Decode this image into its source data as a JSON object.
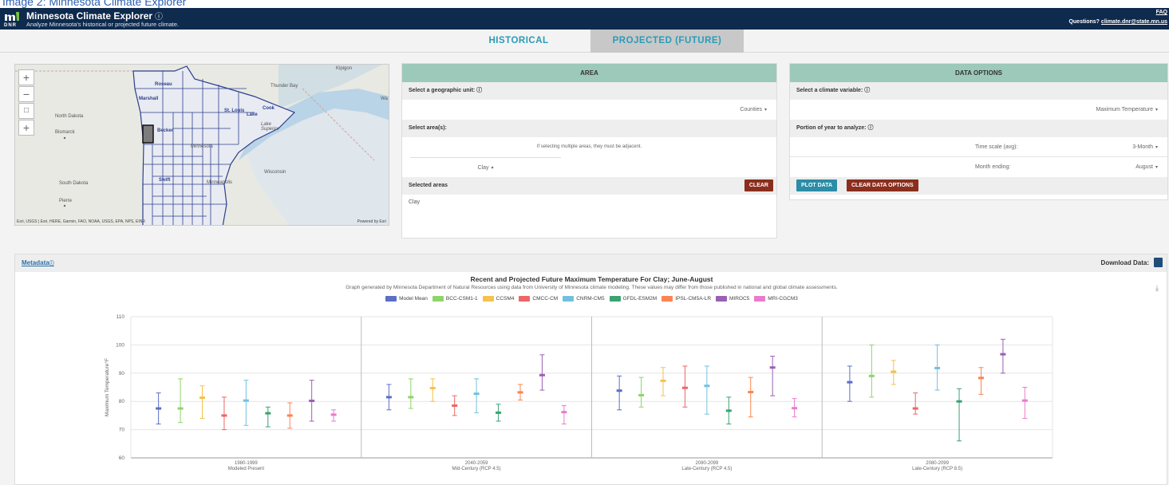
{
  "caption": "Image 2: Minnesota Climate Explorer",
  "header": {
    "title": "Minnesota Climate Explorer",
    "info_glyph": "ⓘ",
    "subtitle": "Analyze Minnesota's historical or projected future climate.",
    "dnr": "DNR",
    "faq": "FAQ",
    "questions_label": "Questions?",
    "questions_email": "climate.dnr@state.mn.us"
  },
  "tabs": {
    "historical": "HISTORICAL",
    "projected": "PROJECTED (FUTURE)"
  },
  "map": {
    "zoom_in": "+",
    "zoom_out": "−",
    "box": "□",
    "plus2": "+",
    "labels": {
      "kipigon": "Kipigon",
      "thunder_bay": "Thunder Bay",
      "north_dakota": "North Dakota",
      "bismarck": "Bismarck",
      "lake_superior": "Lake Superior",
      "south_dakota": "South Dakota",
      "pierre": "Pierre",
      "wisconsin": "Wisconsin",
      "minneapolis": "Minneapolis",
      "minnesota": "Minnesota",
      "roseau": "Roseau",
      "marshall": "Marshall",
      "cook": "Cook",
      "lake": "Lake",
      "st_louis": "St. Louis",
      "becker": "Becker",
      "swift": "Swift",
      "wa": "Wa"
    },
    "credit": "Esri, USGS | Esri, HERE, Garmin, FAO, NOAA, USGS, EPA, NPS, EINR",
    "powered": "Powered by Esri"
  },
  "area": {
    "heading": "AREA",
    "geo_unit_label": "Select a geographic unit: ⓘ",
    "geo_unit_value": "Counties",
    "select_areas_label": "Select area(s):",
    "adjacent_note": "If selecting multiple areas, they must be adjacent.",
    "area_value": "Clay",
    "selected_label": "Selected areas",
    "clear": "CLEAR",
    "selected_value": "Clay"
  },
  "data_options": {
    "heading": "DATA OPTIONS",
    "variable_label": "Select a climate variable: ⓘ",
    "variable_value": "Maximum Temperature",
    "portion_label": "Portion of year to analyze: ⓘ",
    "time_scale_label": "Time scale (avg):",
    "time_scale_value": "3-Month",
    "month_ending_label": "Month ending:",
    "month_ending_value": "August",
    "plot": "PLOT DATA",
    "clear_options": "CLEAR DATA OPTIONS"
  },
  "results": {
    "metadata": "Metadata",
    "metadata_info": "ⓘ",
    "download_label": "Download Data:",
    "download_glyph": "⤓"
  },
  "chart_data": {
    "type": "scatter",
    "title": "Recent and Projected Future Maximum Temperature For Clay; June-August",
    "subtitle": "Graph generated by Minnesota Department of Natural Resources using data from University of Minnesota climate modeling. These values may differ from those published in national and global climate assessments.",
    "ylabel": "Maximum Temperature°F",
    "ylim": [
      60,
      110
    ],
    "yticks": [
      60,
      70,
      80,
      90,
      100,
      110
    ],
    "groups": [
      [
        "1980-1999",
        "Modeled Present"
      ],
      [
        "2040-2059",
        "Mid-Century (RCP 4.5)"
      ],
      [
        "2080-2099",
        "Late-Century (RCP 4.5)"
      ],
      [
        "2080-2099",
        "Late-Century (RCP 8.5)"
      ]
    ],
    "legend_position": "top-center",
    "grid": true,
    "series": [
      {
        "name": "Model Mean",
        "color": "#5b6fc7",
        "values": [
          [
            77.5,
            72,
            83
          ],
          [
            81.5,
            77,
            86
          ],
          [
            83.8,
            77,
            89
          ],
          [
            86.8,
            80,
            92.5
          ]
        ]
      },
      {
        "name": "BCC-CSM1-1",
        "color": "#8fd46a",
        "values": [
          [
            77.5,
            72.5,
            88
          ],
          [
            81.5,
            77.5,
            88
          ],
          [
            82.2,
            78,
            88.5
          ],
          [
            89,
            81.5,
            100
          ]
        ]
      },
      {
        "name": "CCSM4",
        "color": "#f5c24c",
        "values": [
          [
            81.3,
            74,
            85.5
          ],
          [
            84.7,
            80,
            88
          ],
          [
            87.3,
            82,
            92
          ],
          [
            90.5,
            86,
            94.5
          ]
        ]
      },
      {
        "name": "CMCC-CM",
        "color": "#ee6666",
        "values": [
          [
            75,
            70,
            81.5
          ],
          [
            78.5,
            75,
            82
          ],
          [
            84.8,
            78,
            92.5
          ],
          [
            77.5,
            75.5,
            83
          ]
        ]
      },
      {
        "name": "CNRM-CM5",
        "color": "#73c0de",
        "values": [
          [
            80.3,
            71.5,
            87.5
          ],
          [
            82.7,
            76,
            88
          ],
          [
            85.5,
            75.5,
            92.5
          ],
          [
            91.8,
            84,
            100
          ]
        ]
      },
      {
        "name": "GFDL-ESM2M",
        "color": "#3ba272",
        "values": [
          [
            75.8,
            71,
            78
          ],
          [
            76,
            73,
            79
          ],
          [
            76.7,
            72,
            81.5
          ],
          [
            80,
            66,
            84.5
          ]
        ]
      },
      {
        "name": "IPSL-CM5A-LR",
        "color": "#fc8452",
        "values": [
          [
            75,
            70.5,
            79.5
          ],
          [
            83.2,
            80.5,
            86
          ],
          [
            83.3,
            74.5,
            88.5
          ],
          [
            88.3,
            82.5,
            92
          ]
        ]
      },
      {
        "name": "MIROC5",
        "color": "#9a60b4",
        "values": [
          [
            80.2,
            73,
            87.5
          ],
          [
            89.3,
            84,
            96.5
          ],
          [
            92,
            82,
            96
          ],
          [
            96.7,
            90,
            102
          ]
        ]
      },
      {
        "name": "MRI-CGCM3",
        "color": "#ea7ccc",
        "values": [
          [
            75.3,
            73,
            77
          ],
          [
            76.2,
            72,
            78.5
          ],
          [
            77.6,
            74.5,
            81
          ],
          [
            80.3,
            74,
            85
          ]
        ]
      }
    ]
  }
}
